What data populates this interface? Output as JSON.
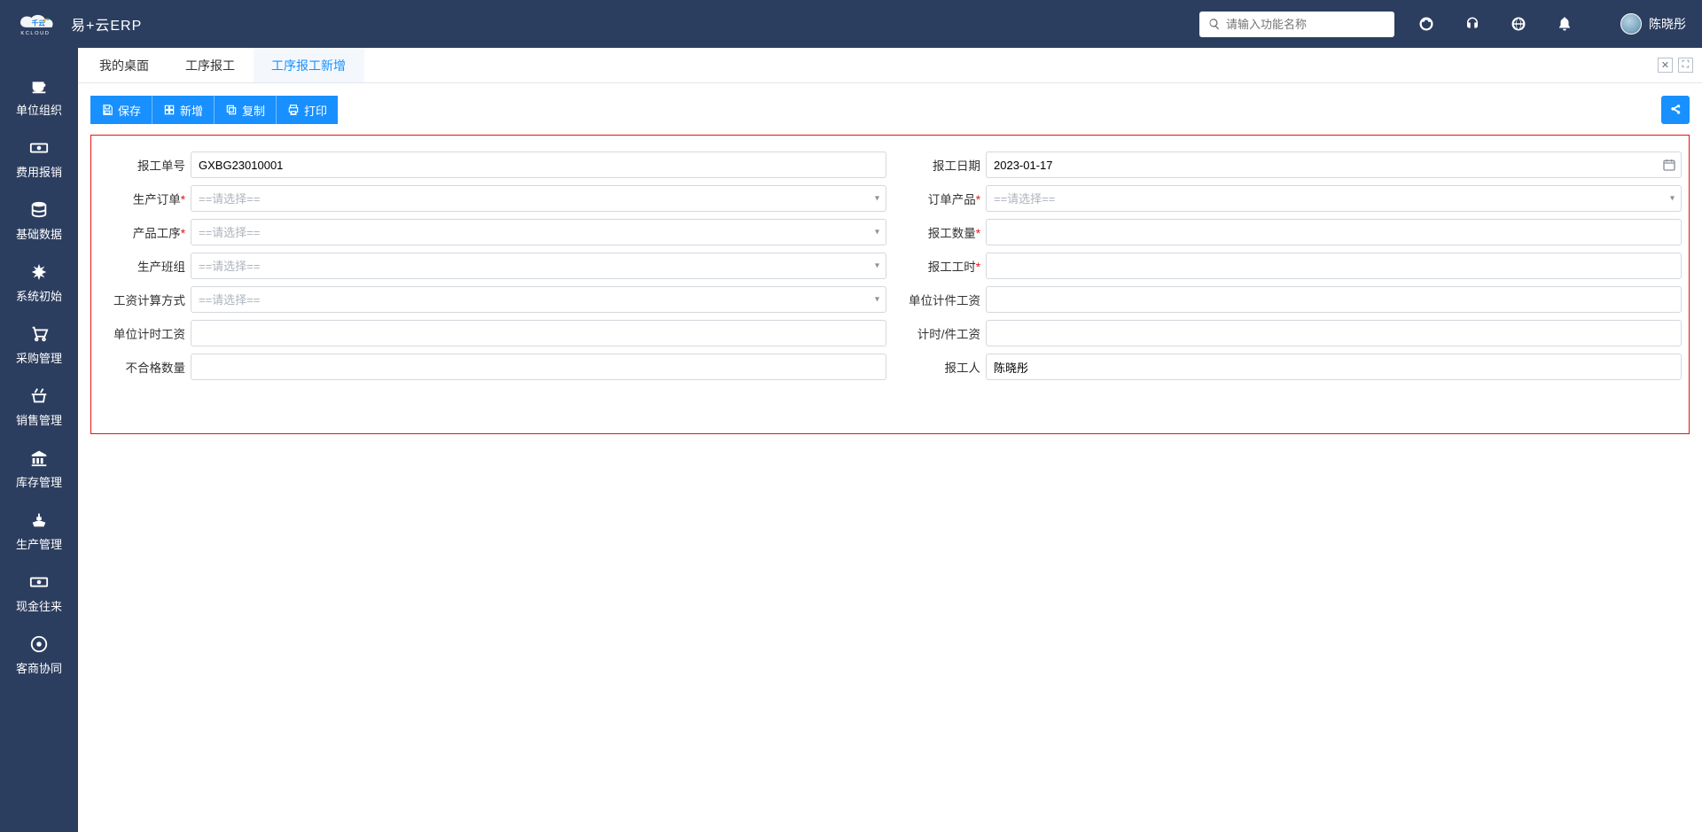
{
  "header": {
    "product_name": "易+云ERP",
    "search_placeholder": "请输入功能名称",
    "username": "陈晓彤"
  },
  "sidebar": {
    "items": [
      {
        "label": "单位组织",
        "icon": "coffee"
      },
      {
        "label": "费用报销",
        "icon": "banknote"
      },
      {
        "label": "基础数据",
        "icon": "database"
      },
      {
        "label": "系统初始",
        "icon": "asterisk"
      },
      {
        "label": "采购管理",
        "icon": "cart"
      },
      {
        "label": "销售管理",
        "icon": "basket"
      },
      {
        "label": "库存管理",
        "icon": "bank"
      },
      {
        "label": "生产管理",
        "icon": "ship"
      },
      {
        "label": "现金往来",
        "icon": "banknote"
      },
      {
        "label": "客商协同",
        "icon": "collab"
      }
    ]
  },
  "tabs": [
    {
      "label": "我的桌面",
      "active": false
    },
    {
      "label": "工序报工",
      "active": false
    },
    {
      "label": "工序报工新增",
      "active": true
    }
  ],
  "toolbar": {
    "save_label": "保存",
    "new_label": "新增",
    "copy_label": "复制",
    "print_label": "打印"
  },
  "form": {
    "select_placeholder": "==请选择==",
    "report_no": {
      "label": "报工单号",
      "value": "GXBG23010001"
    },
    "report_date": {
      "label": "报工日期",
      "value": "2023-01-17"
    },
    "prod_order": {
      "label": "生产订单"
    },
    "order_product": {
      "label": "订单产品"
    },
    "product_process": {
      "label": "产品工序"
    },
    "report_qty": {
      "label": "报工数量"
    },
    "prod_team": {
      "label": "生产班组"
    },
    "report_hours": {
      "label": "报工工时"
    },
    "salary_calc": {
      "label": "工资计算方式"
    },
    "unit_piece_salary": {
      "label": "单位计件工资"
    },
    "unit_time_salary": {
      "label": "单位计时工资"
    },
    "time_piece_salary": {
      "label": "计时/件工资"
    },
    "reject_qty": {
      "label": "不合格数量"
    },
    "reporter": {
      "label": "报工人",
      "value": "陈晓彤"
    }
  }
}
